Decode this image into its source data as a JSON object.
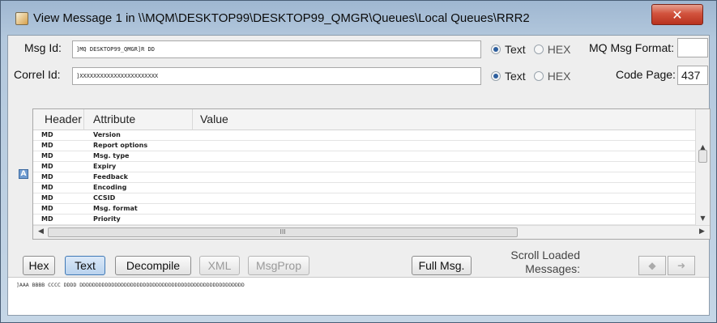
{
  "window": {
    "title": "View Message 1 in \\\\MQM\\DESKTOP99\\DESKTOP99_QMGR\\Queues\\Local Queues\\RRR2",
    "close_glyph": "✕"
  },
  "msg_id": {
    "label": "Msg Id:",
    "value": "]MQ DESKTOP99_QMGR]R DD",
    "format_options": [
      "Text",
      "HEX"
    ],
    "selected_format": "Text"
  },
  "correl_id": {
    "label": "Correl Id:",
    "value": "]XXXXXXXXXXXXXXXXXXXXXXX",
    "format_options": [
      "Text",
      "HEX"
    ],
    "selected_format": "Text"
  },
  "mq_msg_format": {
    "label": "MQ Msg Format:",
    "value": ""
  },
  "code_page": {
    "label": "Code Page:",
    "value": "437"
  },
  "table": {
    "columns": [
      "Header",
      "Attribute",
      "Value"
    ],
    "rows": [
      {
        "header": "MD",
        "attribute": "Version",
        "value": ""
      },
      {
        "header": "MD",
        "attribute": "Report options",
        "value": ""
      },
      {
        "header": "MD",
        "attribute": "Msg. type",
        "value": ""
      },
      {
        "header": "MD",
        "attribute": "Expiry",
        "value": ""
      },
      {
        "header": "MD",
        "attribute": "Feedback",
        "value": ""
      },
      {
        "header": "MD",
        "attribute": "Encoding",
        "value": ""
      },
      {
        "header": "MD",
        "attribute": "CCSID",
        "value": ""
      },
      {
        "header": "MD",
        "attribute": "Msg. format",
        "value": ""
      },
      {
        "header": "MD",
        "attribute": "Priority",
        "value": ""
      }
    ],
    "scroll_grip": "III"
  },
  "side_marker": "A",
  "buttons": {
    "hex": "Hex",
    "text": "Text",
    "decompile": "Decompile",
    "xml": "XML",
    "msgprop": "MsgProp",
    "full_msg": "Full Msg."
  },
  "scroll_loaded": {
    "line1": "Scroll Loaded",
    "line2": "Messages:"
  },
  "nav": {
    "prev_glyph": "◆",
    "next_glyph": "➜"
  },
  "message_data": "]AAA BBBB CCCC DDDD DDDDDDDDDDDDDDDDDDDDDDDDDDDDDDDDDDDDDDDDDDDDDDDDDDDD"
}
